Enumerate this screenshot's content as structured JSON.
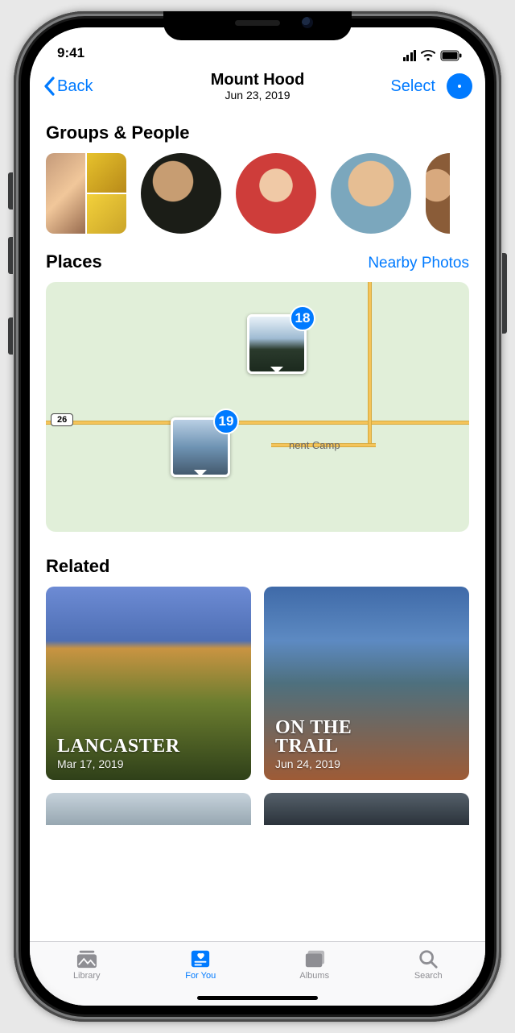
{
  "status": {
    "time": "9:41"
  },
  "nav": {
    "back_label": "Back",
    "title": "Mount Hood",
    "subtitle": "Jun 23, 2019",
    "select_label": "Select"
  },
  "sections": {
    "people_title": "Groups & People",
    "places_title": "Places",
    "places_action": "Nearby Photos",
    "related_title": "Related"
  },
  "map": {
    "route_shield": "26",
    "place_label": "nent Camp",
    "pins": [
      {
        "count": "18"
      },
      {
        "count": "19"
      }
    ]
  },
  "related": [
    {
      "title": "LANCASTER",
      "date": "Mar 17, 2019"
    },
    {
      "title": "ON THE\nTRAIL",
      "date": "Jun 24, 2019"
    }
  ],
  "tabs": {
    "library": "Library",
    "for_you": "For You",
    "albums": "Albums",
    "search": "Search"
  }
}
